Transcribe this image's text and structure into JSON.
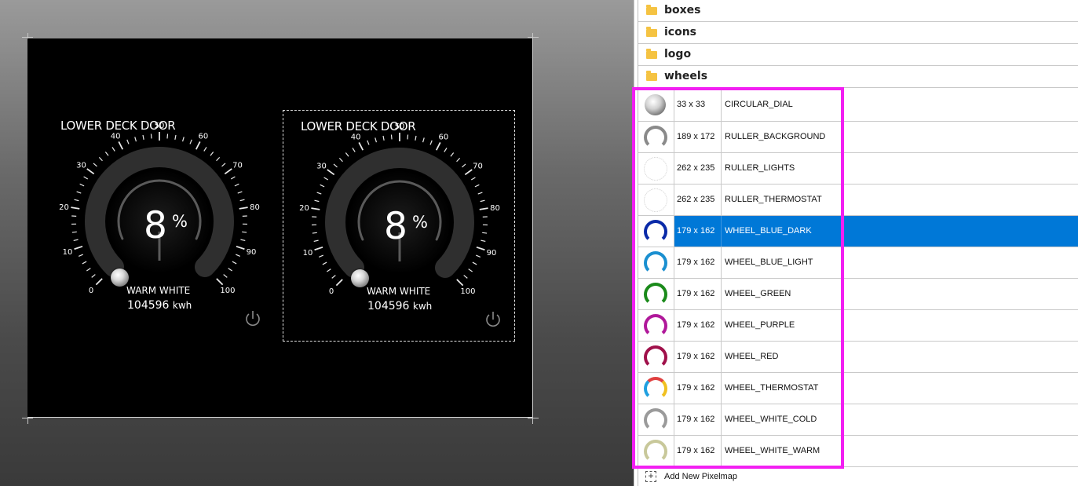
{
  "canvas": {
    "widgets": [
      {
        "title": "LOWER DECK DOOR",
        "value": "8",
        "unit": "%",
        "mode": "WARM WHITE",
        "energy": "104596",
        "energy_unit": "kwh",
        "scale_labels": [
          "0",
          "10",
          "20",
          "30",
          "40",
          "50",
          "60",
          "70",
          "80",
          "90",
          "100"
        ],
        "level_percent": 8,
        "selected": false
      },
      {
        "title": "LOWER DECK DOOR",
        "value": "8",
        "unit": "%",
        "mode": "WARM WHITE",
        "energy": "104596",
        "energy_unit": "kwh",
        "scale_labels": [
          "0",
          "10",
          "20",
          "30",
          "40",
          "50",
          "60",
          "70",
          "80",
          "90",
          "100"
        ],
        "level_percent": 8,
        "selected": true
      }
    ],
    "icons": [
      "power-icon",
      "knob-icon"
    ]
  },
  "panel": {
    "folders": [
      {
        "label": "boxes",
        "icon": "folder-icon"
      },
      {
        "label": "icons",
        "icon": "folder-icon"
      },
      {
        "label": "logo",
        "icon": "folder-icon"
      },
      {
        "label": "wheels",
        "icon": "folder-open-icon"
      }
    ],
    "pixelmaps": [
      {
        "size": "33 x 33",
        "name": "CIRCULAR_DIAL",
        "thumb": "dial",
        "color": "#b0b0b0"
      },
      {
        "size": "189 x 172",
        "name": "RULLER_BACKGROUND",
        "thumb": "ring",
        "color": "#8a8a8a"
      },
      {
        "size": "262 x 235",
        "name": "RULLER_LIGHTS",
        "thumb": "dots",
        "color": "#d0d0d0"
      },
      {
        "size": "262 x 235",
        "name": "RULLER_THERMOSTAT",
        "thumb": "dots",
        "color": "#d0d0d0"
      },
      {
        "size": "179 x 162",
        "name": "WHEEL_BLUE_DARK",
        "thumb": "ring",
        "color": "#0a2aa8",
        "selected": true
      },
      {
        "size": "179 x 162",
        "name": "WHEEL_BLUE_LIGHT",
        "thumb": "ring",
        "color": "#1a8fd0"
      },
      {
        "size": "179 x 162",
        "name": "WHEEL_GREEN",
        "thumb": "ring",
        "color": "#1a8a1a"
      },
      {
        "size": "179 x 162",
        "name": "WHEEL_PURPLE",
        "thumb": "ring",
        "color": "#b0189a"
      },
      {
        "size": "179 x 162",
        "name": "WHEEL_RED",
        "thumb": "ring",
        "color": "#a0104a"
      },
      {
        "size": "179 x 162",
        "name": "WHEEL_THERMOSTAT",
        "thumb": "ring-multi",
        "color": "#e04040"
      },
      {
        "size": "179 x 162",
        "name": "WHEEL_WHITE_COLD",
        "thumb": "ring",
        "color": "#9a9a9a"
      },
      {
        "size": "179 x 162",
        "name": "WHEEL_WHITE_WARM",
        "thumb": "ring",
        "color": "#c8c89a"
      }
    ],
    "add_label": "Add New Pixelmap",
    "highlight_color": "#f21ff2",
    "selection_color": "#0078d7"
  }
}
